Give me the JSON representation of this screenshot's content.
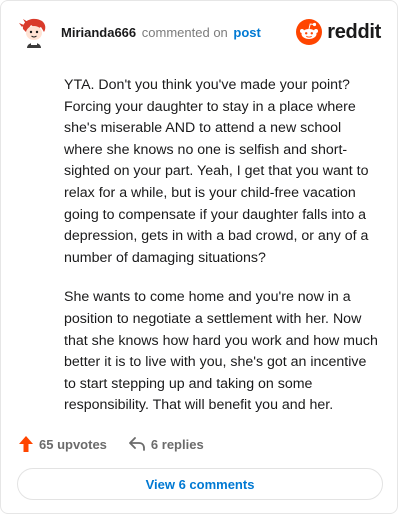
{
  "header": {
    "username": "Mirianda666",
    "action_text": "commented on",
    "post_link": "post",
    "brand": "reddit"
  },
  "comment": {
    "paragraphs": [
      "YTA. Don't you think you've made your point? Forcing your daughter to stay in a place where she's miserable AND to attend a new school where she knows no one is selfish and short-sighted on your part. Yeah, I get that you want to relax for a while, but is your child-free vacation going to compensate if your daughter falls into a depression, gets in with a bad crowd, or any of a number of damaging situations?",
      "She wants to come home and you're now in a position to negotiate a settlement with her. Now that she knows how hard you work and how much better it is to live with you, she's got an incentive to start stepping up and taking on some responsibility. That will benefit you and her."
    ]
  },
  "actions": {
    "upvotes": "65 upvotes",
    "replies": "6 replies"
  },
  "footer": {
    "view_comments": "View 6 comments"
  },
  "colors": {
    "reddit_orange": "#ff4500",
    "link_blue": "#0079d3",
    "avatar_red": "#d93a2b"
  },
  "icons": {
    "avatar": "snoo-avatar-icon",
    "brand": "reddit-logo-icon",
    "upvote": "upvote-arrow-icon",
    "reply": "reply-arrow-icon"
  }
}
